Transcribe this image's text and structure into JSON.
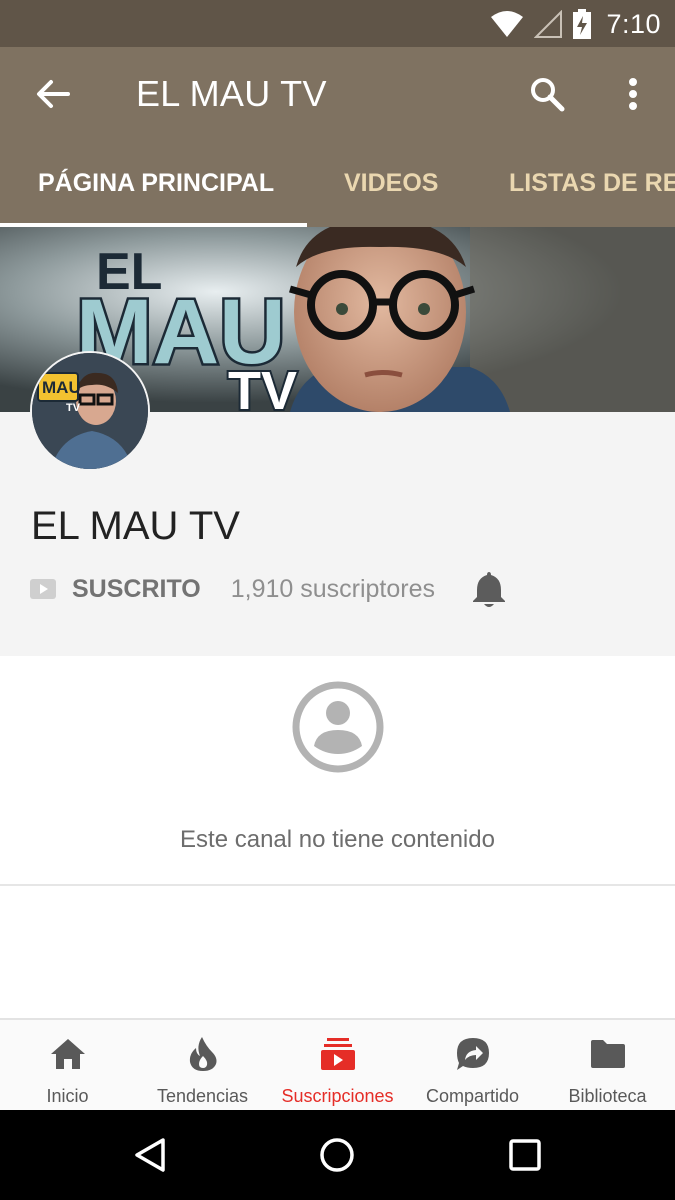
{
  "status_bar": {
    "time": "7:10",
    "icons": [
      "wifi-icon",
      "signal-icon",
      "battery-charging-icon"
    ]
  },
  "app_bar": {
    "title": "EL MAU TV",
    "back_icon": "arrow-back-icon",
    "search_icon": "search-icon",
    "more_icon": "more-vert-icon"
  },
  "tabs": [
    {
      "label": "PÁGINA PRINCIPAL",
      "active": true
    },
    {
      "label": "VIDEOS",
      "active": false
    },
    {
      "label": "LISTAS DE REPRODUCCIÓN",
      "active": false
    }
  ],
  "banner": {
    "logo_text": "EL MAU TV"
  },
  "avatar": {
    "logo_text": "MAU TV"
  },
  "channel": {
    "name": "EL MAU TV",
    "subscribed_label": "SUSCRITO",
    "subscriber_count": "1,910 suscriptores",
    "bell_icon": "bell-icon"
  },
  "empty_state": {
    "icon": "account-circle-icon",
    "message": "Este canal no tiene contenido"
  },
  "bottom_nav": [
    {
      "label": "Inicio",
      "icon": "home-icon",
      "active": false
    },
    {
      "label": "Tendencias",
      "icon": "trending-fire-icon",
      "active": false
    },
    {
      "label": "Suscripciones",
      "icon": "subscriptions-icon",
      "active": true
    },
    {
      "label": "Compartido",
      "icon": "shared-icon",
      "active": false
    },
    {
      "label": "Biblioteca",
      "icon": "folder-icon",
      "active": false
    }
  ],
  "system_nav": [
    "back-triangle-icon",
    "home-circle-icon",
    "recents-square-icon"
  ],
  "colors": {
    "status_bar": "#605548",
    "app_bar": "#7f7261",
    "tab_inactive": "#ead7b0",
    "accent_red": "#e52d27",
    "channel_bg": "#f4f4f4"
  }
}
